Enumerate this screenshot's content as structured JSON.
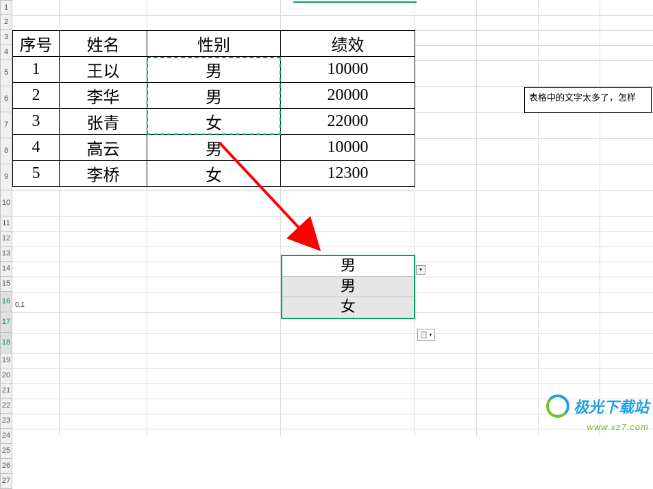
{
  "row_heads": [
    {
      "n": "1",
      "h": 22
    },
    {
      "n": "2",
      "h": 22
    },
    {
      "n": "3",
      "h": 22
    },
    {
      "n": "4",
      "h": 22
    },
    {
      "n": "5",
      "h": 38
    },
    {
      "n": "6",
      "h": 38
    },
    {
      "n": "7",
      "h": 38
    },
    {
      "n": "8",
      "h": 38
    },
    {
      "n": "9",
      "h": 38
    },
    {
      "n": "10",
      "h": 38
    },
    {
      "n": "11",
      "h": 22
    },
    {
      "n": "12",
      "h": 22
    },
    {
      "n": "13",
      "h": 22
    },
    {
      "n": "14",
      "h": 22
    },
    {
      "n": "15",
      "h": 22
    },
    {
      "n": "16",
      "h": 30,
      "sel": true
    },
    {
      "n": "17",
      "h": 30,
      "sel": true
    },
    {
      "n": "18",
      "h": 30,
      "sel": true
    },
    {
      "n": "19",
      "h": 22
    },
    {
      "n": "20",
      "h": 22
    },
    {
      "n": "21",
      "h": 22
    },
    {
      "n": "22",
      "h": 22
    },
    {
      "n": "23",
      "h": 22
    },
    {
      "n": "24",
      "h": 22
    },
    {
      "n": "25",
      "h": 22
    },
    {
      "n": "26",
      "h": 22
    },
    {
      "n": "27",
      "h": 22
    }
  ],
  "table": {
    "headers": [
      "序号",
      "姓名",
      "性别",
      "绩效"
    ],
    "rows": [
      [
        "1",
        "王以",
        "男",
        "10000"
      ],
      [
        "2",
        "李华",
        "男",
        "20000"
      ],
      [
        "3",
        "张青",
        "女",
        "22000"
      ],
      [
        "4",
        "高云",
        "男",
        "10000"
      ],
      [
        "5",
        "李桥",
        "女",
        "12300"
      ]
    ]
  },
  "pasted": [
    "男",
    "男",
    "女"
  ],
  "cell_a18": "0.1",
  "comment": "表格中的文字太多了，怎样",
  "paste_options_glyph": "📋",
  "watermark": {
    "cn": "极光下载站",
    "url": "www.xz7.com"
  },
  "chart_data": {
    "type": "table",
    "title": "",
    "columns": [
      "序号",
      "姓名",
      "性别",
      "绩效"
    ],
    "rows": [
      [
        1,
        "王以",
        "男",
        10000
      ],
      [
        2,
        "李华",
        "男",
        20000
      ],
      [
        3,
        "张青",
        "女",
        22000
      ],
      [
        4,
        "高云",
        "男",
        10000
      ],
      [
        5,
        "李桥",
        "女",
        12300
      ]
    ]
  },
  "vlines": [
    68,
    196,
    391,
    587,
    677,
    767,
    857
  ],
  "hlines": [
    22,
    44,
    66,
    88,
    126,
    164,
    202,
    240,
    278,
    316,
    338,
    360,
    382,
    404,
    426,
    456,
    486,
    516,
    538,
    560,
    582,
    604,
    626
  ]
}
